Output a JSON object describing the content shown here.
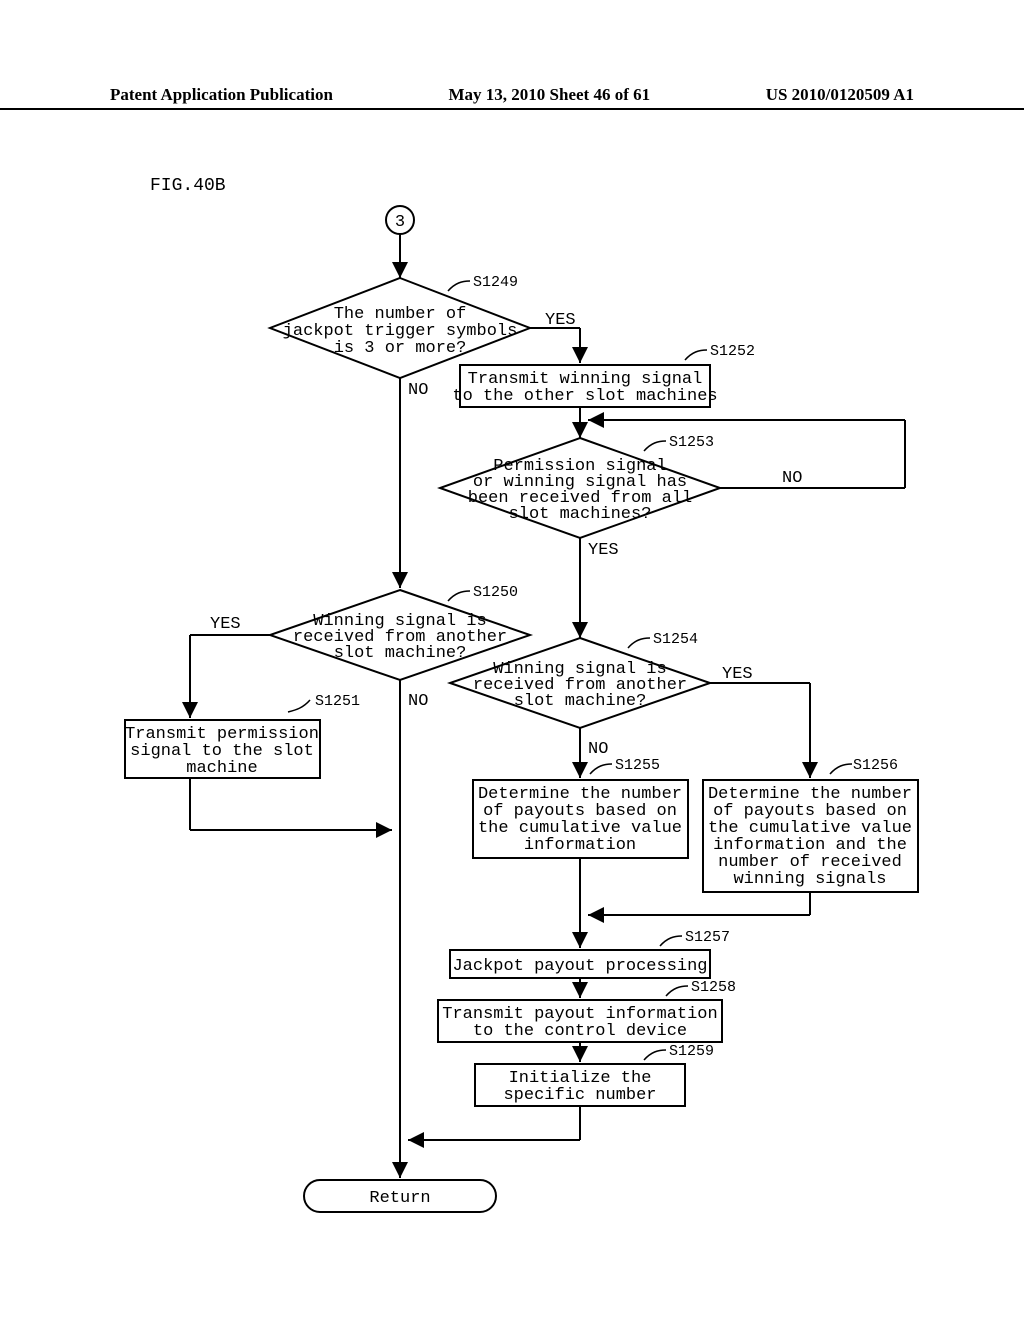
{
  "header": {
    "left": "Patent Application Publication",
    "center": "May 13, 2010  Sheet 46 of 61",
    "right": "US 2010/0120509 A1"
  },
  "figure_label": "FIG.40B",
  "connector": "3",
  "nodes": {
    "s1249": {
      "id": "S1249",
      "text": [
        "The number of",
        "jackpot trigger symbols",
        "is 3 or more?"
      ],
      "yes": "YES",
      "no": "NO"
    },
    "s1252": {
      "id": "S1252",
      "text": [
        "Transmit winning signal",
        "to the other slot machines"
      ]
    },
    "s1253": {
      "id": "S1253",
      "text": [
        "Permission signal",
        "or winning signal has",
        "been received from all",
        "slot machines?"
      ],
      "yes": "YES",
      "no": "NO"
    },
    "s1250": {
      "id": "S1250",
      "text": [
        "Winning signal is",
        "received from another",
        "slot machine?"
      ],
      "yes": "YES",
      "no": "NO"
    },
    "s1251": {
      "id": "S1251",
      "text": [
        "Transmit permission",
        "signal to the slot",
        "machine"
      ]
    },
    "s1254": {
      "id": "S1254",
      "text": [
        "Winning signal is",
        "received from another",
        "slot machine?"
      ],
      "yes": "YES",
      "no": "NO"
    },
    "s1255": {
      "id": "S1255",
      "text": [
        "Determine the number",
        "of payouts based on",
        "the cumulative value",
        "information"
      ]
    },
    "s1256": {
      "id": "S1256",
      "text": [
        "Determine the number",
        "of payouts based on",
        "the cumulative value",
        "information and the",
        "number of received",
        "winning signals"
      ]
    },
    "s1257": {
      "id": "S1257",
      "text": [
        "Jackpot payout processing"
      ]
    },
    "s1258": {
      "id": "S1258",
      "text": [
        "Transmit payout information",
        "to the control device"
      ]
    },
    "s1259": {
      "id": "S1259",
      "text": [
        "Initialize the",
        "specific number"
      ]
    },
    "return": {
      "text": "Return"
    }
  }
}
